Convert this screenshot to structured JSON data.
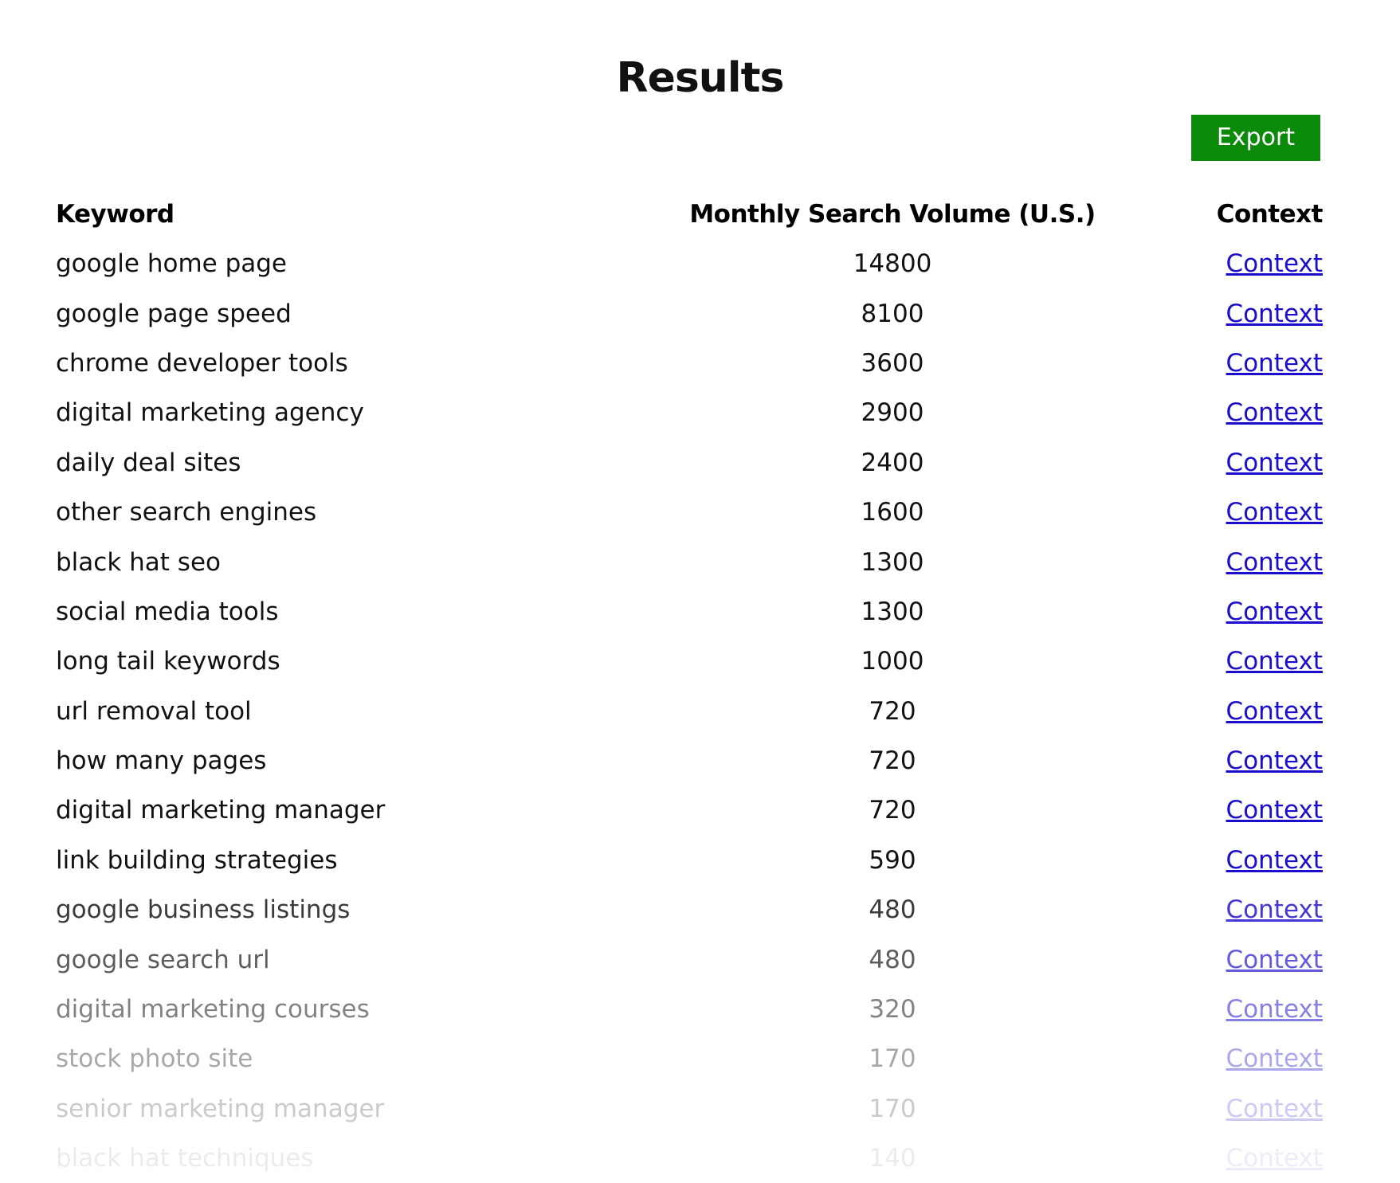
{
  "page": {
    "title": "Results"
  },
  "toolbar": {
    "export_label": "Export",
    "export_color": "#0b8a0b"
  },
  "table": {
    "headers": {
      "keyword": "Keyword",
      "volume": "Monthly Search Volume (U.S.)",
      "context": "Context"
    },
    "rows": [
      {
        "keyword": "google home page",
        "volume": "14800",
        "context": "Context"
      },
      {
        "keyword": "google page speed",
        "volume": "8100",
        "context": "Context"
      },
      {
        "keyword": "chrome developer tools",
        "volume": "3600",
        "context": "Context"
      },
      {
        "keyword": "digital marketing agency",
        "volume": "2900",
        "context": "Context"
      },
      {
        "keyword": "daily deal sites",
        "volume": "2400",
        "context": "Context"
      },
      {
        "keyword": "other search engines",
        "volume": "1600",
        "context": "Context"
      },
      {
        "keyword": "black hat seo",
        "volume": "1300",
        "context": "Context"
      },
      {
        "keyword": "social media tools",
        "volume": "1300",
        "context": "Context"
      },
      {
        "keyword": "long tail keywords",
        "volume": "1000",
        "context": "Context"
      },
      {
        "keyword": "url removal tool",
        "volume": "720",
        "context": "Context"
      },
      {
        "keyword": "how many pages",
        "volume": "720",
        "context": "Context"
      },
      {
        "keyword": "digital marketing manager",
        "volume": "720",
        "context": "Context"
      },
      {
        "keyword": "link building strategies",
        "volume": "590",
        "context": "Context"
      },
      {
        "keyword": "google business listings",
        "volume": "480",
        "context": "Context"
      },
      {
        "keyword": "google search url",
        "volume": "480",
        "context": "Context"
      },
      {
        "keyword": "digital marketing courses",
        "volume": "320",
        "context": "Context"
      },
      {
        "keyword": "stock photo site",
        "volume": "170",
        "context": "Context"
      },
      {
        "keyword": "senior marketing manager",
        "volume": "170",
        "context": "Context"
      },
      {
        "keyword": "black hat techniques",
        "volume": "140",
        "context": "Context"
      }
    ]
  },
  "colors": {
    "link": "#1a0dcc",
    "text": "#111111"
  }
}
